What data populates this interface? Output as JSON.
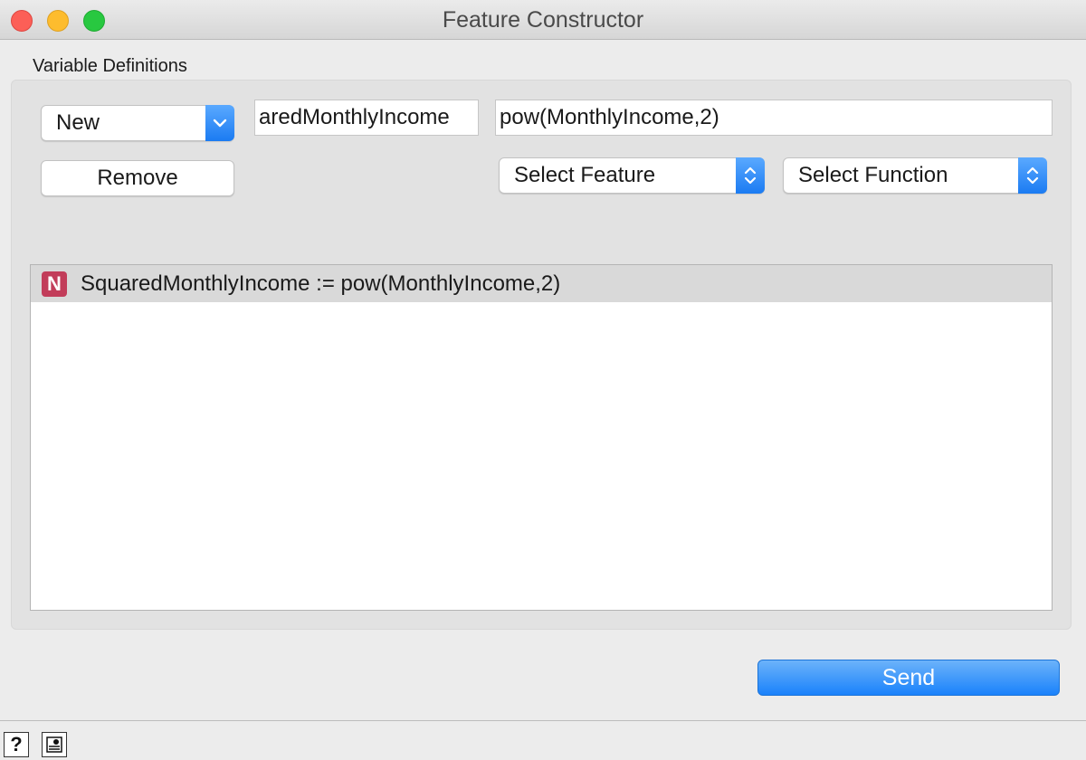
{
  "window": {
    "title": "Feature Constructor"
  },
  "group": {
    "label": "Variable Definitions"
  },
  "controls": {
    "new_popup": "New",
    "remove_button": "Remove",
    "name_field_value": "aredMonthlyIncome",
    "expression_field_value": "pow(MonthlyIncome,2)",
    "select_feature": "Select Feature",
    "select_function": "Select Function"
  },
  "list": {
    "items": [
      {
        "badge": "N",
        "text": "SquaredMonthlyIncome := pow(MonthlyIncome,2)"
      }
    ]
  },
  "actions": {
    "send_label": "Send"
  },
  "statusbar": {
    "help_glyph": "?"
  },
  "colors": {
    "badge": "#c23d5a",
    "accent": "#1a82fb"
  }
}
